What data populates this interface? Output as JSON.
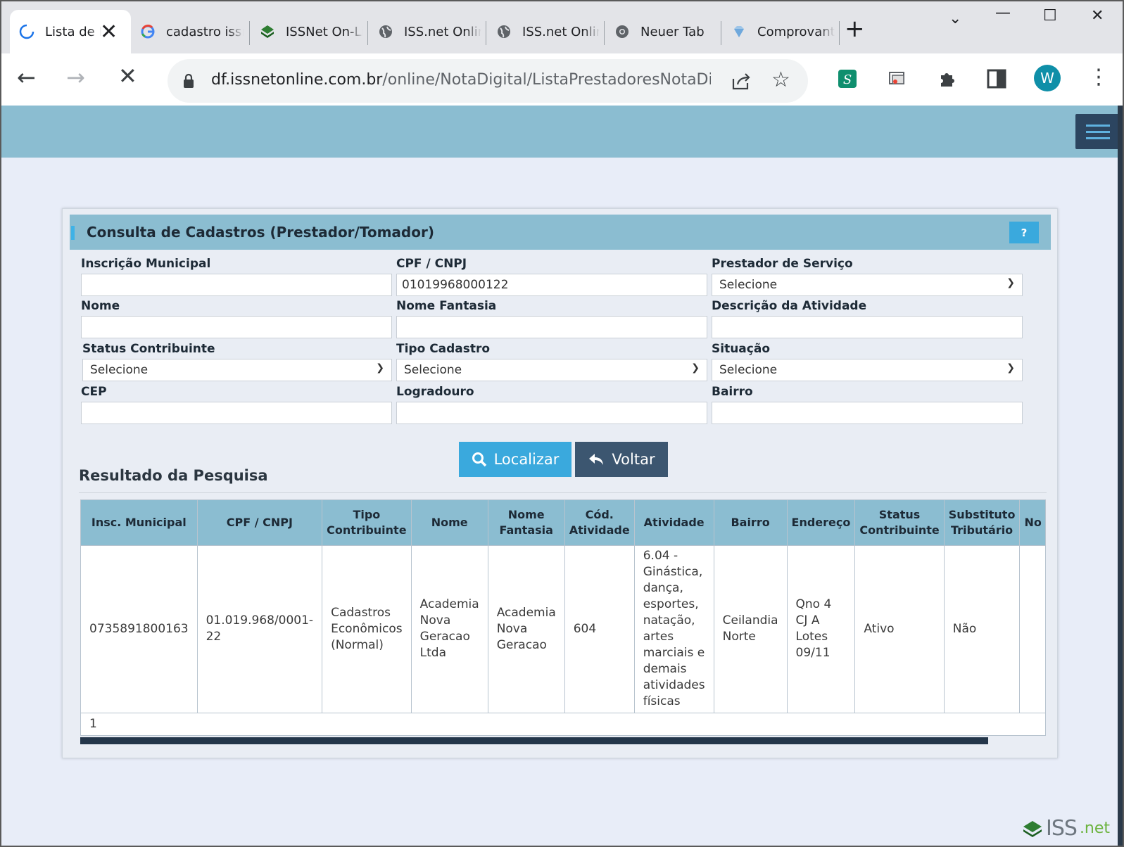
{
  "browser": {
    "tabs": [
      {
        "label": "Lista de Prestadores",
        "icon": "loading-spinner-icon",
        "active": true
      },
      {
        "label": "cadastro issnet",
        "icon": "google-icon"
      },
      {
        "label": "ISSNet On-Line",
        "icon": "issnet-icon"
      },
      {
        "label": "ISS.net Online",
        "icon": "globe-icon"
      },
      {
        "label": "ISS.net Online",
        "icon": "globe-icon"
      },
      {
        "label": "Neuer Tab",
        "icon": "chrome-icon"
      },
      {
        "label": "Comprovante",
        "icon": "diamond-icon"
      }
    ],
    "url_host": "df.issnetonline.com.br",
    "url_path": "/online/NotaDigital/ListaPrestadoresNotaDigital...",
    "avatar_letter": "W"
  },
  "panel": {
    "title": "Consulta de Cadastros (Prestador/Tomador)",
    "help_label": "?"
  },
  "form": {
    "inscricao_label": "Inscrição Municipal",
    "inscricao_value": "",
    "cpf_label": "CPF / CNPJ",
    "cpf_value": "01019968000122",
    "prestador_label": "Prestador de Serviço",
    "prestador_value": "Selecione",
    "nome_label": "Nome",
    "nome_value": "",
    "fantasia_label": "Nome Fantasia",
    "fantasia_value": "",
    "descricao_label": "Descrição da Atividade",
    "descricao_value": "",
    "status_label": "Status Contribuinte",
    "status_value": "Selecione",
    "tipo_label": "Tipo Cadastro",
    "tipo_value": "Selecione",
    "situacao_label": "Situação",
    "situacao_value": "Selecione",
    "cep_label": "CEP",
    "cep_value": "",
    "logradouro_label": "Logradouro",
    "logradouro_value": "",
    "bairro_label": "Bairro",
    "bairro_value": "",
    "localizar_label": "Localizar",
    "voltar_label": "Voltar"
  },
  "results": {
    "title": "Resultado da Pesquisa",
    "columns": [
      "Insc. Municipal",
      "CPF / CNPJ",
      "Tipo Contribuinte",
      "Nome",
      "Nome Fantasia",
      "Cód. Atividade",
      "Atividade",
      "Bairro",
      "Endereço",
      "Status Contribuinte",
      "Substituto Tributário",
      "No"
    ],
    "row": [
      "0735891800163",
      "01.019.968/0001-22",
      "Cadastros Econômicos (Normal)",
      "Academia Nova Geracao Ltda",
      "Academia Nova Geracao",
      "604",
      "6.04 - Ginástica, dança, esportes, natação, artes marciais e demais atividades físicas",
      "Ceilandia Norte",
      "Qno 4 CJ A Lotes 09/11",
      "Ativo",
      "Não",
      ""
    ],
    "page": "1"
  },
  "footer": {
    "logo_iss": "ISS",
    "logo_net": ".net"
  },
  "colors": {
    "header_blue": "#8bbdd1",
    "accent_blue": "#3aa9dd",
    "dark_button": "#3c5670"
  }
}
